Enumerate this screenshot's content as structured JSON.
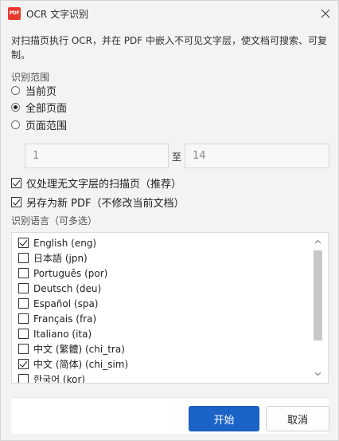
{
  "window": {
    "title": "OCR 文字识别",
    "app_icon_text": "PDF"
  },
  "description": "对扫描页执行 OCR，并在 PDF 中嵌入不可见文字层，使文档可搜索、可复制。",
  "range": {
    "label": "识别范围",
    "options": [
      {
        "label": "当前页",
        "selected": false
      },
      {
        "label": "全部页面",
        "selected": true
      },
      {
        "label": "页面范围",
        "selected": false
      }
    ],
    "from_value": "1",
    "to_label": "至",
    "to_value": "14"
  },
  "options": {
    "skip_text_pages": {
      "label": "仅处理无文字层的扫描页（推荐）",
      "checked": true
    },
    "save_as_new": {
      "label": "另存为新 PDF（不修改当前文档）",
      "checked": true
    }
  },
  "languages": {
    "label": "识别语言（可多选）",
    "items": [
      {
        "label": "English (eng)",
        "checked": true
      },
      {
        "label": "日本語 (jpn)",
        "checked": false
      },
      {
        "label": "Português (por)",
        "checked": false
      },
      {
        "label": "Deutsch (deu)",
        "checked": false
      },
      {
        "label": "Español (spa)",
        "checked": false
      },
      {
        "label": "Français (fra)",
        "checked": false
      },
      {
        "label": "Italiano (ita)",
        "checked": false
      },
      {
        "label": "中文 (繁體) (chi_tra)",
        "checked": false
      },
      {
        "label": "中文 (简体) (chi_sim)",
        "checked": true
      },
      {
        "label": "한국어 (kor)",
        "checked": false
      }
    ]
  },
  "buttons": {
    "start": "开始",
    "cancel": "取消"
  },
  "colors": {
    "primary": "#1b63c7",
    "app_icon": "#e83a2c"
  }
}
